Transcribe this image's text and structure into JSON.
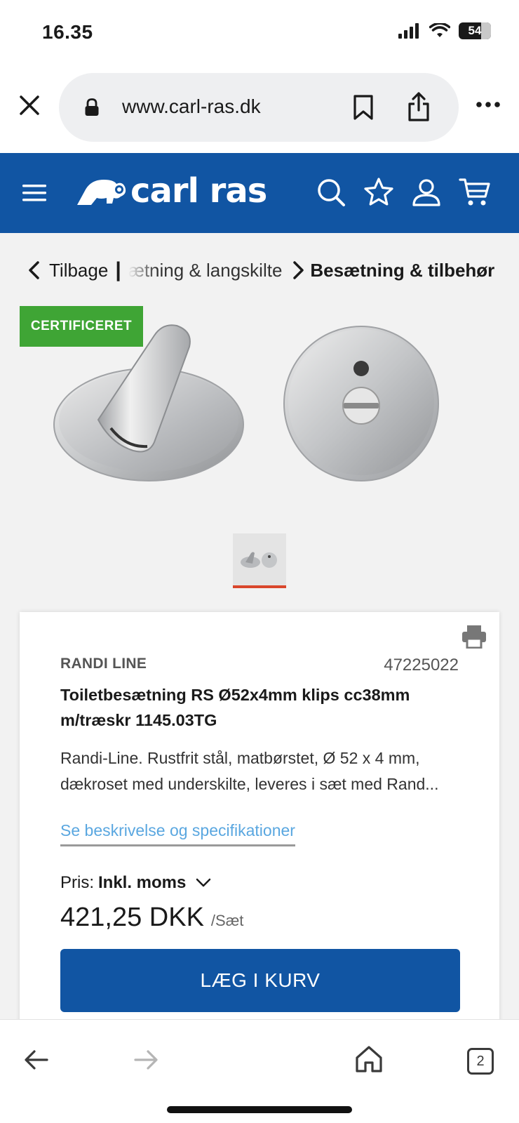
{
  "status": {
    "time": "16.35",
    "battery": "54"
  },
  "browser": {
    "url": "www.carl-ras.dk",
    "tab_count": "2"
  },
  "site": {
    "logo_text": "carl ras",
    "brand_color": "#1155a3"
  },
  "breadcrumb": {
    "back_label": "Tilbage",
    "separator": "|",
    "middle": "ætning & langskilte",
    "current": "Besætning & tilbehør"
  },
  "product": {
    "badge": "CERTIFICERET",
    "brand": "RANDI LINE",
    "sku": "47225022",
    "title": "Toiletbesætning RS Ø52x4mm klips cc38mm m/træskr 1145.03TG",
    "description": "Randi-Line. Rustfrit stål, matbørstet, Ø 52 x 4 mm, dækroset med underskilte, leveres i sæt med Rand...",
    "spec_link": "Se beskrivelse og specifikationer",
    "price_label": "Pris:",
    "price_mode": "Inkl. moms",
    "price": "421,25 DKK",
    "unit": "/Sæt",
    "cta": "LÆG I KURV"
  },
  "colors": {
    "badge_green": "#3fa535",
    "link_blue": "#5aa7e0",
    "thumb_indicator": "#d9462b"
  },
  "icons": [
    "close-icon",
    "lock-icon",
    "bookmark-icon",
    "share-icon",
    "more-icon",
    "menu-icon",
    "search-icon",
    "star-icon",
    "user-icon",
    "cart-icon",
    "chevron-left-icon",
    "chevron-right-icon",
    "print-icon",
    "chevron-down-icon",
    "back-arrow-icon",
    "forward-arrow-icon",
    "home-icon"
  ]
}
